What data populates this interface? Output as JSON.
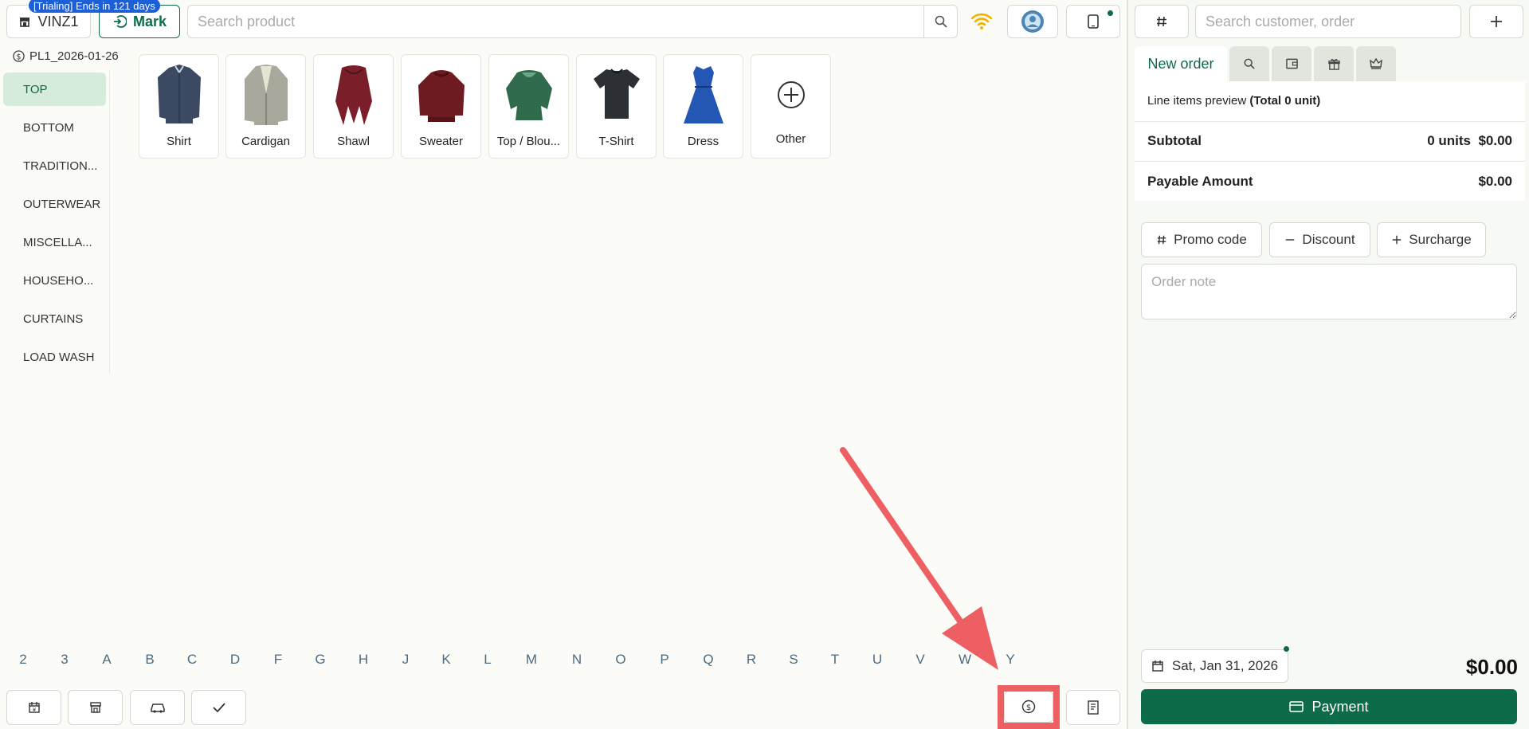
{
  "header": {
    "trial_badge": "[Trialing] Ends in 121 days",
    "store_label": "VINZ1",
    "mark_label": "Mark",
    "search_placeholder": "Search product"
  },
  "pricelist": "PL1_2026-01-26",
  "categories": [
    "TOP",
    "BOTTOM",
    "TRADITION...",
    "OUTERWEAR",
    "MISCELLA...",
    "HOUSEHO...",
    "CURTAINS",
    "LOAD WASH"
  ],
  "products": [
    {
      "label": "Shirt",
      "color": "#3b4a62"
    },
    {
      "label": "Cardigan",
      "color": "#a9a89c"
    },
    {
      "label": "Shawl",
      "color": "#7a1f2a"
    },
    {
      "label": "Sweater",
      "color": "#6e1c22"
    },
    {
      "label": "Top / Blou...",
      "color": "#2f6b4c"
    },
    {
      "label": "T-Shirt",
      "color": "#2c2f33"
    },
    {
      "label": "Dress",
      "color": "#2456b3"
    },
    {
      "label": "Other",
      "color": "#333333"
    }
  ],
  "alphabet": [
    "2",
    "3",
    "A",
    "B",
    "C",
    "D",
    "F",
    "G",
    "H",
    "J",
    "K",
    "L",
    "M",
    "N",
    "O",
    "P",
    "Q",
    "R",
    "S",
    "T",
    "U",
    "V",
    "W",
    "Y"
  ],
  "right": {
    "customer_search_placeholder": "Search customer, order",
    "tabs": [
      {
        "label": "New order"
      }
    ],
    "preview_prefix": "Line items preview",
    "preview_total": "(Total 0 unit)",
    "subtotal_label": "Subtotal",
    "subtotal_units": "0 units",
    "subtotal_value": "$0.00",
    "payable_label": "Payable Amount",
    "payable_value": "$0.00",
    "promo_label": "Promo code",
    "discount_label": "Discount",
    "surcharge_label": "Surcharge",
    "note_placeholder": "Order note",
    "date_label": "Sat, Jan 31, 2026",
    "total": "$0.00",
    "payment_label": "Payment"
  },
  "colors": {
    "brand": "#0d6b47",
    "active_bg": "#d7ebdd",
    "badge": "#1d5fd6",
    "annotation": "#ee5f63",
    "wifi": "#f0b400"
  },
  "icons": {
    "store": "store-icon",
    "mark": "mark-login-icon",
    "search": "search-icon",
    "wifi": "wifi-icon",
    "avatar": "avatar-icon",
    "tablet": "tablet-icon",
    "pricelist": "dollar-circle-icon",
    "bottom_buttons": [
      "calendar-icon",
      "shop-icon",
      "car-icon",
      "check-icon",
      "dollar-circle-icon",
      "receipt-icon"
    ]
  }
}
